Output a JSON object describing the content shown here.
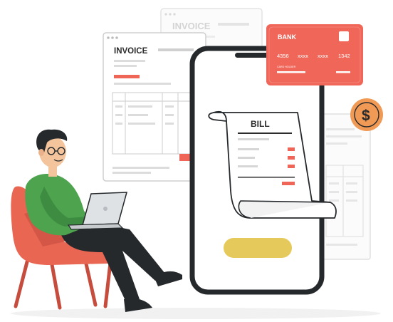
{
  "invoice_back": {
    "title": "INVOICE"
  },
  "invoice_front": {
    "title": "INVOICE"
  },
  "bill": {
    "title": "BILL"
  },
  "bank_card": {
    "bank_name": "BANK",
    "number_parts": [
      "4356",
      "xxxx",
      "xxxx",
      "1342"
    ],
    "holder_label": "CARD HOLDER"
  },
  "coin": {
    "symbol": "$"
  },
  "colors": {
    "accent_red": "#ef6658",
    "card_red": "#f0675a",
    "phone_frame": "#26292c",
    "pay_button": "#e5c95a",
    "coin_orange": "#f09a56",
    "shirt_green": "#4da34e",
    "chair_coral": "#e86652"
  }
}
